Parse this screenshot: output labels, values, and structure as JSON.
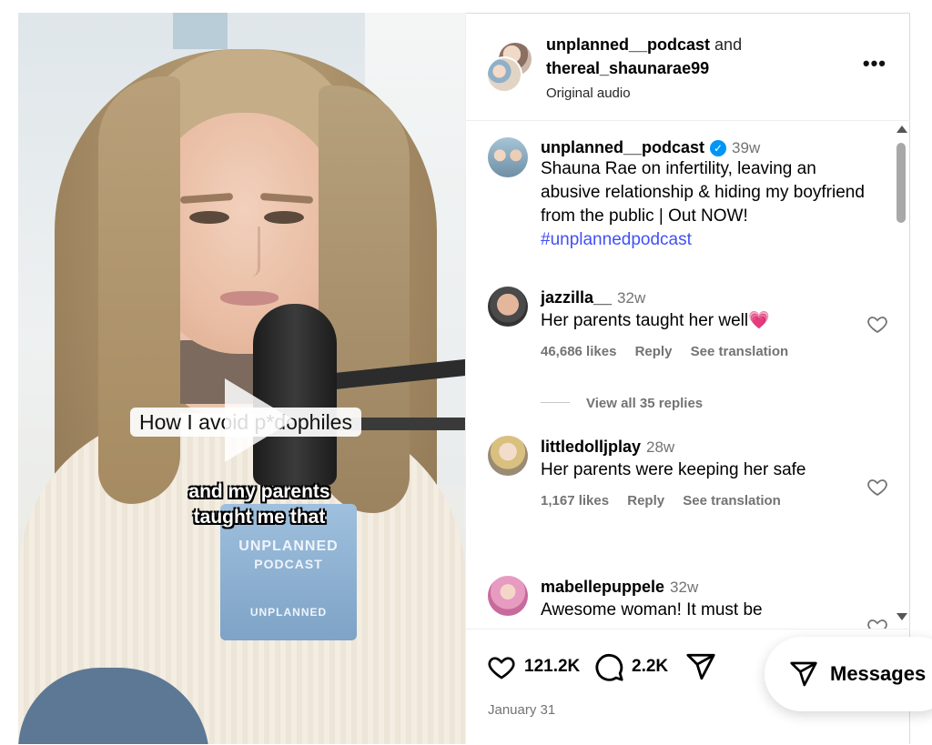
{
  "video": {
    "caption_top": "How I avoid p*dophiles",
    "caption_bottom_line1": "and my parents",
    "caption_bottom_line2": "taught me that",
    "mic_flag_text1": "UNPLANNED",
    "mic_flag_text2": "PODCAST",
    "mic_flag_text3": "UNPLANNED"
  },
  "header": {
    "author1": "unplanned__podcast",
    "connector": "and",
    "author2": "thereal_shaunarae99",
    "audio": "Original audio"
  },
  "post": {
    "username": "unplanned__podcast",
    "verified": true,
    "time": "39w",
    "caption": "Shauna Rae on infertility, leaving an abusive relationship & hiding my boyfriend from the public | Out NOW!",
    "hashtag": "#unplannedpodcast"
  },
  "comments": [
    {
      "username": "jazzilla__",
      "time": "32w",
      "text": "Her parents taught her well",
      "emoji": "💗",
      "likes": "46,686 likes",
      "reply": "Reply",
      "translate": "See translation",
      "replies": "View all 35 replies"
    },
    {
      "username": "littledolljplay",
      "time": "28w",
      "text": "Her parents were keeping her safe",
      "likes": "1,167 likes",
      "reply": "Reply",
      "translate": "See translation"
    },
    {
      "username": "mabellepuppele",
      "time": "32w",
      "text": "Awesome woman! It must be"
    }
  ],
  "actions": {
    "likes": "121.2K",
    "comments": "2.2K",
    "date": "January 31"
  },
  "messages": {
    "label": "Messages"
  },
  "colors": {
    "hashtag": "#4150f7",
    "verified": "#0095f6",
    "secondary_text": "#737373",
    "emoji_heart": "#f0508a"
  },
  "icons": [
    "more-options-icon",
    "verified-icon",
    "heart-icon",
    "comment-icon",
    "share-icon",
    "messages-icon",
    "play-icon"
  ]
}
